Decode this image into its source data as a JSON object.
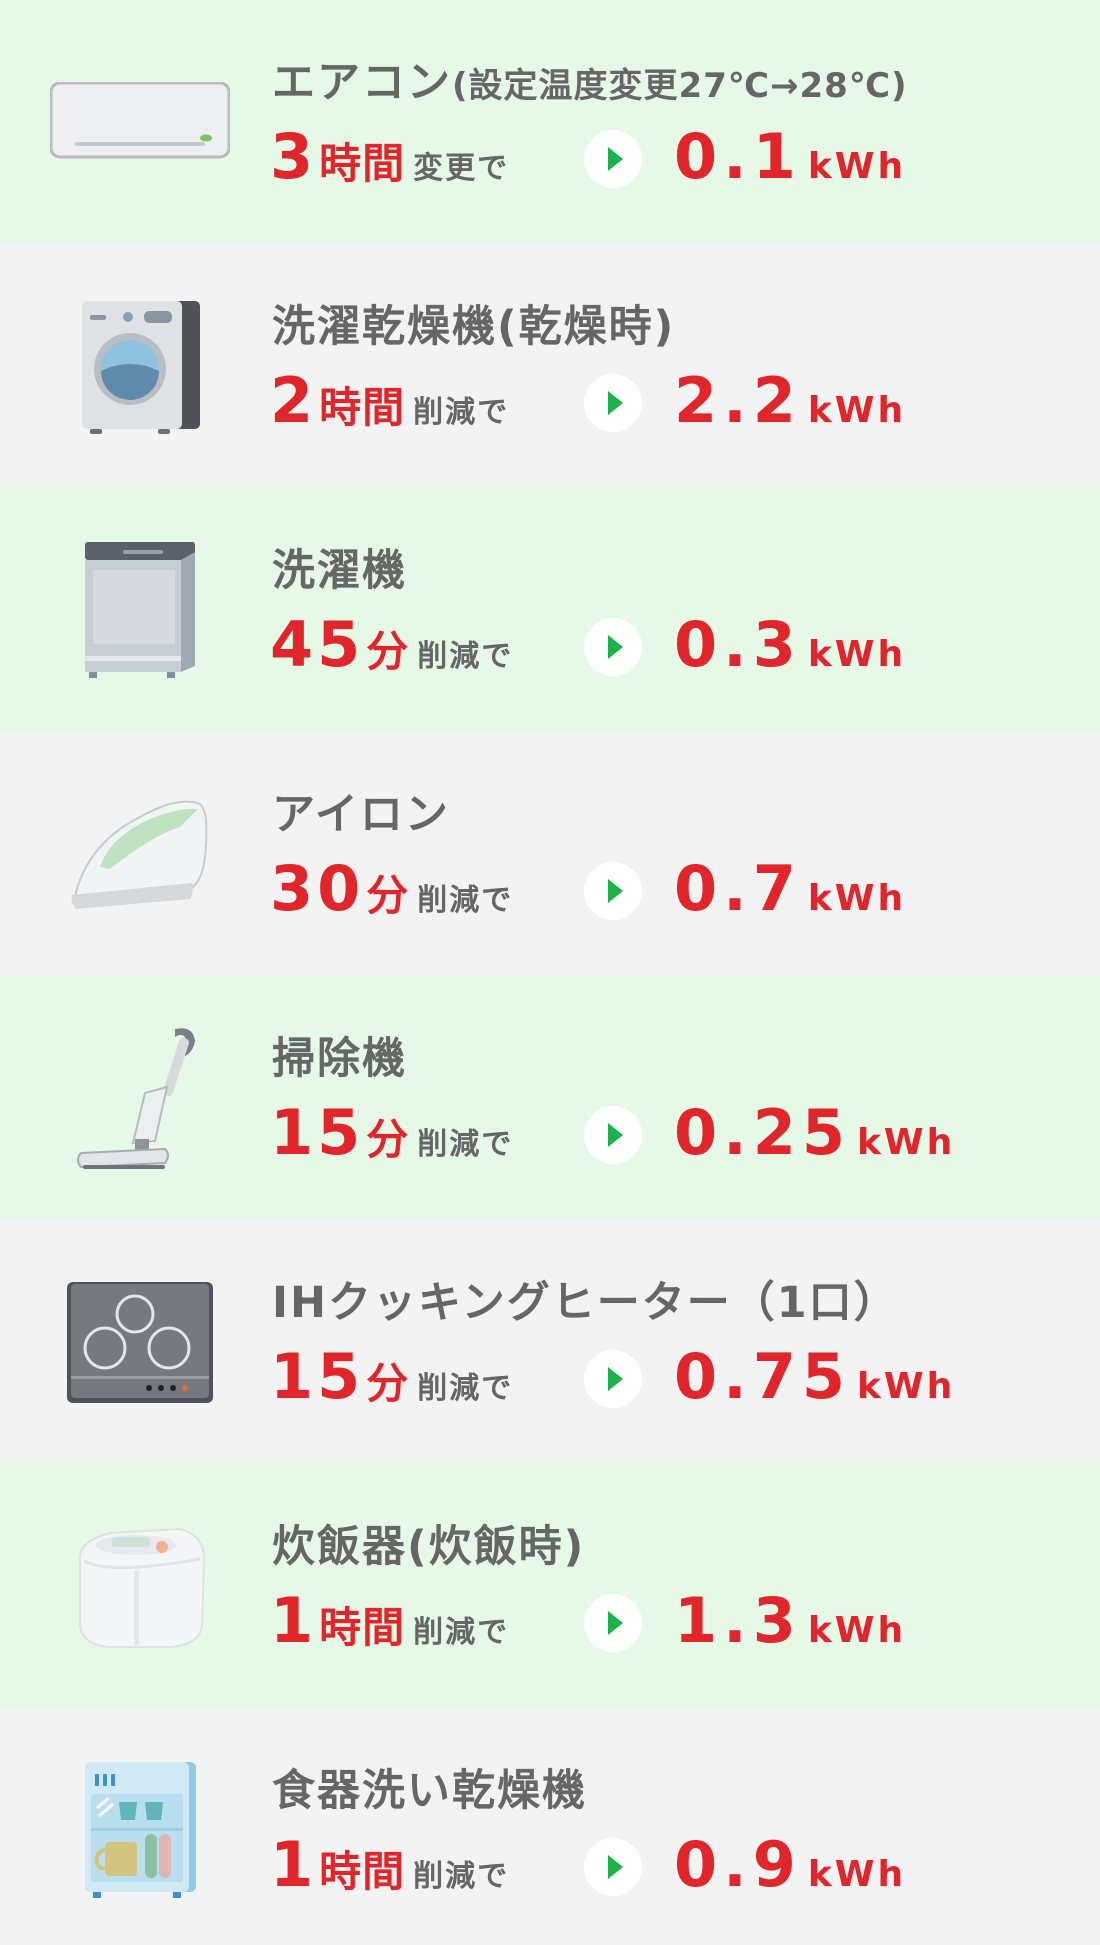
{
  "colors": {
    "accent_red": "#e0262b",
    "arrow_green": "#1db34a",
    "row_green": "#e6f8e8",
    "row_gray": "#f3f3f3",
    "text_gray": "#666666"
  },
  "items": [
    {
      "icon": "air-conditioner-icon",
      "name": "エアコン",
      "sub": "(設定温度変更27℃→28℃)",
      "amount": "3",
      "unit": "時間",
      "action": "変更で",
      "result": "0.1",
      "result_unit": "kWh"
    },
    {
      "icon": "washer-dryer-icon",
      "name": "洗濯乾燥機(乾燥時)",
      "sub": "",
      "amount": "2",
      "unit": "時間",
      "action": "削減で",
      "result": "2.2",
      "result_unit": "kWh"
    },
    {
      "icon": "washing-machine-icon",
      "name": "洗濯機",
      "sub": "",
      "amount": "45",
      "unit": "分",
      "action": "削減で",
      "result": "0.3",
      "result_unit": "kWh"
    },
    {
      "icon": "iron-icon",
      "name": "アイロン",
      "sub": "",
      "amount": "30",
      "unit": "分",
      "action": "削減で",
      "result": "0.7",
      "result_unit": "kWh"
    },
    {
      "icon": "vacuum-cleaner-icon",
      "name": "掃除機",
      "sub": "",
      "amount": "15",
      "unit": "分",
      "action": "削減で",
      "result": "0.25",
      "result_unit": "kWh"
    },
    {
      "icon": "ih-cooktop-icon",
      "name": "IHクッキングヒーター（1口）",
      "sub": "",
      "amount": "15",
      "unit": "分",
      "action": "削減で",
      "result": "0.75",
      "result_unit": "kWh"
    },
    {
      "icon": "rice-cooker-icon",
      "name": "炊飯器(炊飯時)",
      "sub": "",
      "amount": "1",
      "unit": "時間",
      "action": "削減で",
      "result": "1.3",
      "result_unit": "kWh"
    },
    {
      "icon": "dish-dryer-icon",
      "name": "食器洗い乾燥機",
      "sub": "",
      "amount": "1",
      "unit": "時間",
      "action": "削減で",
      "result": "0.9",
      "result_unit": "kWh"
    }
  ]
}
